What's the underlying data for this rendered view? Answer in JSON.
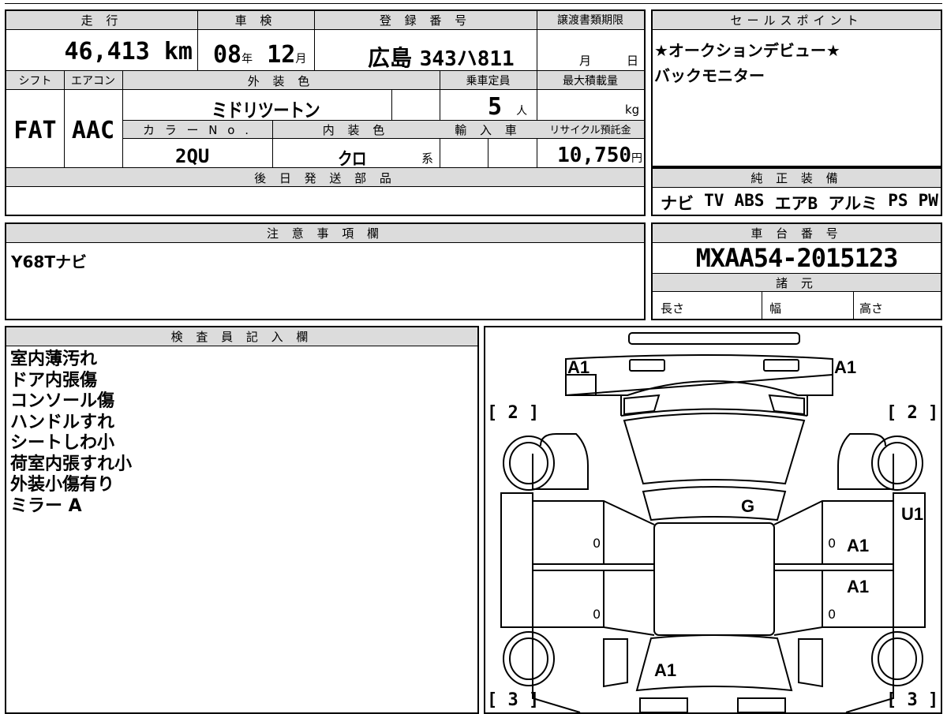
{
  "vehicle": {
    "headers": {
      "mileage": "走 行",
      "inspection": "車 検",
      "registration": "登 録 番 号",
      "transfer_deadline": "譲渡書類期限",
      "shift": "シフト",
      "aircon": "エアコン",
      "exterior_color": "外 装 色",
      "capacity": "乗車定員",
      "max_load": "最大積載量",
      "color_no": "カ ラ ー N o .",
      "interior_color": "内 装 色",
      "imported": "輸 入 車",
      "recycle_fee": "リサイクル預託金",
      "later_parts": "後 日 発 送 部 品"
    },
    "mileage_value": "46,413",
    "mileage_unit": "km",
    "inspection_year": "08",
    "inspection_year_unit": "年",
    "inspection_month": "12",
    "inspection_month_unit": "月",
    "registration_region": "広島",
    "registration_number": "343ハ811",
    "deadline_month_unit": "月",
    "deadline_day_unit": "日",
    "shift_value": "FAT",
    "aircon_value": "AAC",
    "exterior_color_value": "ミドリツートン",
    "capacity_value": "5",
    "capacity_unit": "人",
    "max_load_unit": "kg",
    "color_no_value": "2QU",
    "interior_color_value": "クロ",
    "interior_color_unit": "系",
    "recycle_fee_value": "10,750",
    "recycle_fee_unit": "円"
  },
  "sales_points": {
    "header": "セールスポイント",
    "lines": [
      "★オークションデビュー★",
      "バックモニター"
    ]
  },
  "equipment": {
    "header": "純 正 装 備",
    "items": [
      "ナビ",
      "TV",
      "ABS",
      "エアB",
      "アルミ",
      "PS",
      "PW"
    ]
  },
  "notes": {
    "header": "注 意 事 項 欄",
    "text": "Y68Tナビ"
  },
  "chassis": {
    "header": "車 台 番 号",
    "number": "MXAA54-2015123",
    "spec_header": "諸 元",
    "length_label": "長さ",
    "width_label": "幅",
    "height_label": "高さ"
  },
  "inspector": {
    "header": "検 査 員 記 入 欄",
    "lines": [
      "室内薄汚れ",
      "ドア内張傷",
      "コンソール傷",
      "ハンドルすれ",
      "シートしわ小",
      "荷室内張すれ小",
      "外装小傷有り",
      "ミラー A"
    ]
  },
  "diagram": {
    "marks": {
      "front_left": "A1",
      "front_right": "A1",
      "roof": "G",
      "right_side": "U1",
      "right_front_door": "A1",
      "right_rear_door": "A1",
      "rear": "A1",
      "door_zero_1": "0",
      "door_zero_2": "0",
      "door_zero_3": "0",
      "door_zero_4": "0"
    },
    "brackets": {
      "front_left": "[ 2 ]",
      "front_right": "[ 2 ]",
      "rear_left": "[ 3 ]",
      "rear_right": "[ 3 ]"
    }
  }
}
